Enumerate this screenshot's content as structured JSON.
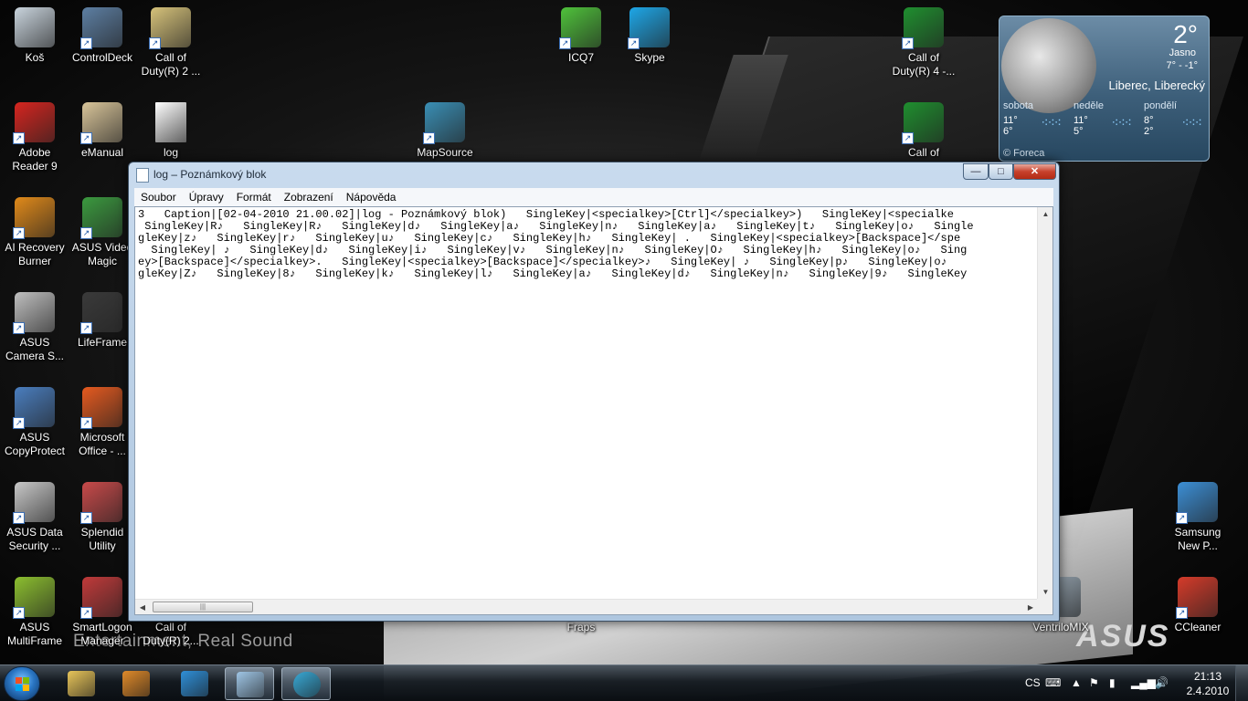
{
  "wallpaper": {
    "slogan": "Entertainment, Real Sound",
    "brand": "ASUS"
  },
  "desktop_icons": [
    {
      "label": "Koš",
      "icon": "recycle-bin-icon",
      "color": "#c9d4dd",
      "shortcut": false
    },
    {
      "label": "ControlDeck",
      "icon": "control-deck-icon",
      "color": "#5d7fa3",
      "shortcut": true
    },
    {
      "label": "Call of Duty(R) 2 ...",
      "icon": "cod2-icon",
      "color": "#d6c27a",
      "shortcut": true
    },
    {
      "label": "ICQ7",
      "icon": "icq-icon",
      "color": "#4fc23b",
      "shortcut": true
    },
    {
      "label": "Skype",
      "icon": "skype-icon",
      "color": "#1ea7e8",
      "shortcut": true
    },
    {
      "label": "Call of Duty(R) 4 -...",
      "icon": "cod4-icon",
      "color": "#1f8f2f",
      "shortcut": true
    },
    {
      "label": "Adobe Reader 9",
      "icon": "adobe-reader-icon",
      "color": "#d6251f",
      "shortcut": true
    },
    {
      "label": "eManual",
      "icon": "emanual-icon",
      "color": "#d9c59a",
      "shortcut": true
    },
    {
      "label": "log",
      "icon": "text-file-icon",
      "color": "#ffffff",
      "shortcut": false
    },
    {
      "label": "MapSource",
      "icon": "mapsource-icon",
      "color": "#3a8fb5",
      "shortcut": true
    },
    {
      "label": "Call of",
      "icon": "cod4-icon-2",
      "color": "#1f8f2f",
      "shortcut": true
    },
    {
      "label": "AI Recovery Burner",
      "icon": "ai-recovery-icon",
      "color": "#e18a1a",
      "shortcut": true
    },
    {
      "label": "ASUS Video Magic",
      "icon": "video-magic-icon",
      "color": "#3b9a3f",
      "shortcut": true
    },
    {
      "label": "ASUS Camera S...",
      "icon": "camera-icon",
      "color": "#bfbfbf",
      "shortcut": true
    },
    {
      "label": "LifeFrame",
      "icon": "lifeframe-icon",
      "color": "#3a3a3a",
      "shortcut": true
    },
    {
      "label": "ASUS CopyProtect",
      "icon": "copyprotect-icon",
      "color": "#4a7ebf",
      "shortcut": true
    },
    {
      "label": "Microsoft Office - ...",
      "icon": "office-icon",
      "color": "#e65a1f",
      "shortcut": true
    },
    {
      "label": "ASUS Data Security ...",
      "icon": "data-security-icon",
      "color": "#c8c8c8",
      "shortcut": true
    },
    {
      "label": "Splendid Utility",
      "icon": "splendid-icon",
      "color": "#c94a4a",
      "shortcut": true
    },
    {
      "label": "Samsung New P...",
      "icon": "samsung-icon",
      "color": "#3c8fd6",
      "shortcut": true
    },
    {
      "label": "ASUS MultiFrame",
      "icon": "multiframe-icon",
      "color": "#8cbf2f",
      "shortcut": true
    },
    {
      "label": "SmartLogon Manager",
      "icon": "smartlogon-icon",
      "color": "#c13a3a",
      "shortcut": true
    },
    {
      "label": "Call of Duty(R) 2...",
      "icon": "cod2-icon-2",
      "color": "#444444",
      "shortcut": true
    },
    {
      "label": "Fraps",
      "icon": "fraps-icon",
      "color": "#333333",
      "shortcut": true
    },
    {
      "label": "VentriloMIX",
      "icon": "ventrilo-icon",
      "color": "#9aa9b5",
      "shortcut": true
    },
    {
      "label": "CCleaner",
      "icon": "ccleaner-icon",
      "color": "#d63b2a",
      "shortcut": true
    }
  ],
  "weather": {
    "temp": "2°",
    "condition": "Jasno",
    "range": "7° - -1°",
    "city": "Liberec, Liberecký",
    "days": [
      {
        "name": "sobota",
        "high": "11°",
        "low": "6°"
      },
      {
        "name": "neděle",
        "high": "11°",
        "low": "5°"
      },
      {
        "name": "pondělí",
        "high": "8°",
        "low": "2°"
      }
    ],
    "source": "© Foreca"
  },
  "notepad": {
    "title": "log – Poznámkový blok",
    "buttons": {
      "minimize": "—",
      "maximize": "□",
      "close": "✕"
    },
    "menu": [
      "Soubor",
      "Úpravy",
      "Formát",
      "Zobrazení",
      "Nápověda"
    ],
    "lines": [
      "3   Caption|[02-04-2010 21.00.02]|log - Poznámkový blok)   SingleKey|<specialkey>[Ctrl]</specialkey>)   SingleKey|<specialke",
      " SingleKey|R♪   SingleKey|R♪   SingleKey|d♪   SingleKey|a♪   SingleKey|n♪   SingleKey|a♪   SingleKey|t♪   SingleKey|o♪   Single",
      "gleKey|z♪   SingleKey|r♪   SingleKey|u♪   SingleKey|c♪   SingleKey|h♪   SingleKey| .   SingleKey|<specialkey>[Backspace]</spe",
      "  SingleKey| ♪   SingleKey|d♪   SingleKey|i♪   SingleKey|v♪   SingleKey|n♪   SingleKey|O♪   SingleKey|h♪   SingleKey|o♪   Sing",
      "ey>[Backspace]</specialkey>.   SingleKey|<specialkey>[Backspace]</specialkey>♪   SingleKey| ♪   SingleKey|p♪   SingleKey|o♪",
      "gleKey|Z♪   SingleKey|8♪   SingleKey|k♪   SingleKey|l♪   SingleKey|a♪   SingleKey|d♪   SingleKey|n♪   SingleKey|9♪   SingleKey"
    ]
  },
  "taskbar": {
    "apps": [
      {
        "name": "explorer",
        "icon": "folder-icon",
        "color": "#e8c55a",
        "active": false
      },
      {
        "name": "media-player",
        "icon": "media-player-icon",
        "color": "#e08a2a",
        "active": false
      },
      {
        "name": "internet-explorer",
        "icon": "ie-icon",
        "color": "#2f8fd8",
        "active": false
      },
      {
        "name": "notepad",
        "icon": "notepad-icon",
        "color": "#9fc6e6",
        "active": true
      },
      {
        "name": "skype-task",
        "icon": "circle-app-icon",
        "color": "#39a9d6",
        "active": true
      }
    ],
    "language": "CS",
    "time": "21:13",
    "date": "2.4.2010"
  }
}
